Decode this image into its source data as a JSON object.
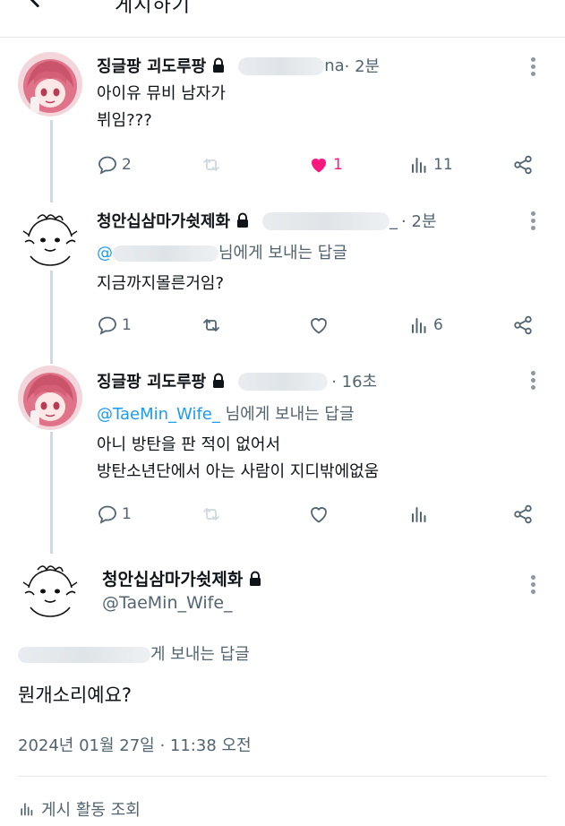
{
  "header": {
    "title": "게시하기"
  },
  "colors": {
    "link": "#1d9bf0",
    "muted": "#536471",
    "like": "#f91880",
    "thread_line": "#cfd9de"
  },
  "tweets": [
    {
      "name": "징글팡 괴도루팡",
      "handle_suffix": "na",
      "time": "· 2분",
      "reply_prefix": "",
      "reply_suffix": "",
      "lines": [
        "아이유 뮤비 남자가",
        "뷔임???"
      ],
      "actions": {
        "replies": "2",
        "retweets": "",
        "likes": "1",
        "views": "11"
      },
      "liked": true
    },
    {
      "name": "청안십삼마가쉿제화",
      "handle_suffix": "_",
      "time": "· 2분",
      "reply_prefix": "@",
      "reply_suffix": "님에게 보내는 답글",
      "lines": [
        "지금까지몰른거임?"
      ],
      "actions": {
        "replies": "1",
        "retweets": "",
        "likes": "",
        "views": "6"
      },
      "liked": false
    },
    {
      "name": "징글팡 괴도루팡",
      "handle_suffix": "",
      "time": "· 16초",
      "reply_prefix": "@TaeMin_Wife_",
      "reply_suffix": "님에게 보내는 답글",
      "lines": [
        "아니 방탄을 판 적이 없어서",
        "방탄소년단에서 아는 사람이 지디밖에없움"
      ],
      "actions": {
        "replies": "1",
        "retweets": "",
        "likes": "",
        "views": ""
      },
      "liked": false
    }
  ],
  "main_tweet": {
    "name": "청안십삼마가쉿제화",
    "handle": "@TaeMin_Wife_",
    "reply_to": "게 보내는 답글",
    "text": "뭔개소리예요?",
    "date": "2024년 01월 27일 · 11:38 오전",
    "activity_label": "게시 활동 조회"
  }
}
